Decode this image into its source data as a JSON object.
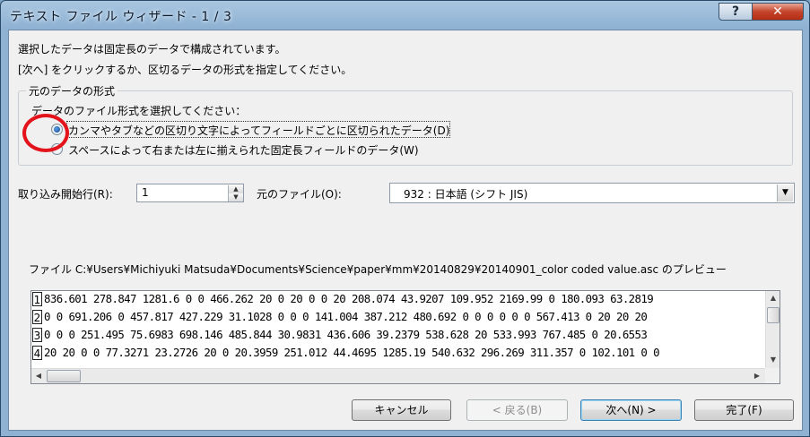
{
  "window": {
    "title": "テキスト ファイル ウィザード - 1 / 3",
    "help_label": "?",
    "close_label": "✕"
  },
  "intro": {
    "line1": "選択したデータは固定長のデータで構成されています。",
    "line2": "[次へ] をクリックするか、区切るデータの形式を指定してください。"
  },
  "format_group": {
    "title": "元のデータの形式",
    "prompt": "データのファイル形式を選択してください：",
    "options": [
      {
        "label": "カンマやタブなどの区切り文字によってフィールドごとに区切られたデータ(D)",
        "selected": true
      },
      {
        "label": "スペースによって右または左に揃えられた固定長フィールドのデータ(W)",
        "selected": false
      }
    ]
  },
  "start_row": {
    "label": "取り込み開始行(R):",
    "value": "1"
  },
  "origin": {
    "label": "元のファイル(O):",
    "value": "932 : 日本語 (シフト JIS)"
  },
  "preview": {
    "caption": "ファイル C:¥Users¥Michiyuki Matsuda¥Documents¥Science¥paper¥mm¥20140829¥20140901_color coded value.asc のプレビュー",
    "rows": [
      {
        "num": "1",
        "text": "836.601 278.847 1281.6 0 0 466.262 20 0 20 0 0 20 208.074 43.9207 109.952 2169.99 0 180.093 63.2819"
      },
      {
        "num": "2",
        "text": "0 0 691.206 0 457.817 427.229 31.1028 0 0 0 141.004 387.212 480.692 0 0 0 0 0 0 567.413 0 20 20 20"
      },
      {
        "num": "3",
        "text": "0 0 0 251.495 75.6983 698.146 485.844 30.9831 436.606 39.2379 538.628 20 533.993 767.485 0 20.6553"
      },
      {
        "num": "4",
        "text": "20 20 0 0 77.3271 23.2726 20 0 20.3959 251.012 44.4695 1285.19 540.632 296.269 311.357 0 102.101 0 0"
      }
    ]
  },
  "buttons": {
    "cancel": "キャンセル",
    "back": "< 戻る(B)",
    "next": "次へ(N) >",
    "finish": "完了(F)"
  },
  "colors": {
    "annotation_circle": "#e3121b",
    "title_bar": "#8fb2d3",
    "client_bg": "#f0f0f0"
  }
}
